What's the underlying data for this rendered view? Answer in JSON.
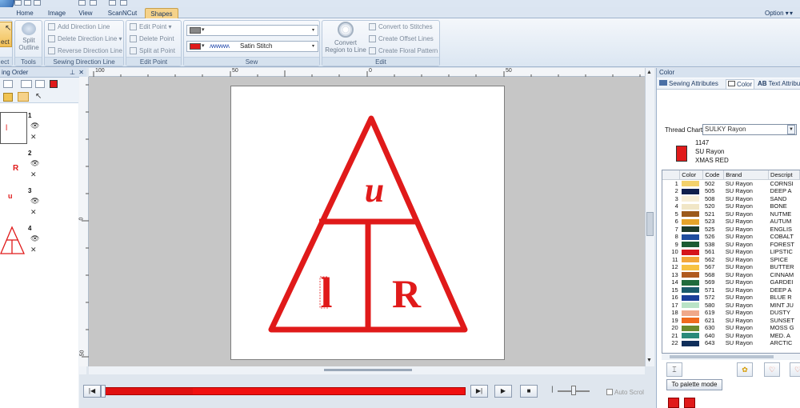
{
  "ribbon_tabs": [
    "Home",
    "Image",
    "View",
    "ScanNCut",
    "Shapes"
  ],
  "active_tab": "Shapes",
  "option_label": "Option",
  "groups": {
    "select": {
      "button": "ect",
      "title": "ect"
    },
    "tools": {
      "button_line1": "Split",
      "button_line2": "Outline",
      "title": "Tools"
    },
    "sewing_direction": {
      "items": [
        "Add Direction Line",
        "Delete Direction Line",
        "Reverse Direction Line"
      ],
      "title": "Sewing Direction Line"
    },
    "edit_point": {
      "items": [
        "Edit Point",
        "Delete Point",
        "Split at Point"
      ],
      "title": "Edit Point"
    },
    "sew": {
      "stitch_type": "Satin Stitch",
      "title": "Sew"
    },
    "edit": {
      "convert_line1": "Convert",
      "convert_line2": "Region to Line",
      "items": [
        "Convert to Stitches",
        "Create Offset Lines",
        "Create Floral Pattern"
      ],
      "title": "Edit"
    }
  },
  "left_panel": {
    "title": "ing Order",
    "items": [
      {
        "num": "1",
        "glyph": "l"
      },
      {
        "num": "2",
        "glyph": "R"
      },
      {
        "num": "3",
        "glyph": "u"
      },
      {
        "num": "4",
        "glyph": ""
      }
    ]
  },
  "ruler": {
    "h_labels": [
      "100",
      "50",
      "0",
      "50"
    ],
    "v_labels": [
      "0",
      "50"
    ]
  },
  "canvas_design": {
    "top_letter": "u",
    "left_letter": "l",
    "right_letter": "R",
    "color": "#e01a1a"
  },
  "player": {
    "auto_scroll": "Auto Scrol"
  },
  "right_panel": {
    "title": "Color",
    "tabs": [
      "Sewing Attributes",
      "Color",
      "Text Attribu"
    ],
    "thread_chart_label": "Thread Chart:",
    "thread_chart_value": "SULKY Rayon",
    "current": {
      "code": "1147",
      "brand": "SU Rayon",
      "name": "XMAS RED",
      "color": "#e01a1a"
    },
    "columns": [
      "",
      "Color",
      "Code",
      "Brand",
      "Descript"
    ],
    "rows": [
      {
        "n": "1",
        "color": "#f3d16b",
        "code": "502",
        "brand": "SU Rayon",
        "desc": "CORNSI"
      },
      {
        "n": "2",
        "color": "#0f1f4d",
        "code": "505",
        "brand": "SU Rayon",
        "desc": "DEEP A"
      },
      {
        "n": "3",
        "color": "#f7efd8",
        "code": "508",
        "brand": "SU Rayon",
        "desc": "SAND"
      },
      {
        "n": "4",
        "color": "#f1e6c6",
        "code": "520",
        "brand": "SU Rayon",
        "desc": "BONE"
      },
      {
        "n": "5",
        "color": "#9c5a1c",
        "code": "521",
        "brand": "SU Rayon",
        "desc": "NUTME"
      },
      {
        "n": "6",
        "color": "#e6a32a",
        "code": "523",
        "brand": "SU Rayon",
        "desc": "AUTUM"
      },
      {
        "n": "7",
        "color": "#1d3b2a",
        "code": "525",
        "brand": "SU Rayon",
        "desc": "ENGLIS"
      },
      {
        "n": "8",
        "color": "#1f4d9e",
        "code": "526",
        "brand": "SU Rayon",
        "desc": "COBALT"
      },
      {
        "n": "9",
        "color": "#1b5b33",
        "code": "538",
        "brand": "SU Rayon",
        "desc": "FOREST"
      },
      {
        "n": "10",
        "color": "#d5151c",
        "code": "561",
        "brand": "SU Rayon",
        "desc": "LIPSTIC"
      },
      {
        "n": "11",
        "color": "#f2a63a",
        "code": "562",
        "brand": "SU Rayon",
        "desc": "SPICE"
      },
      {
        "n": "12",
        "color": "#f7c242",
        "code": "567",
        "brand": "SU Rayon",
        "desc": "BUTTER"
      },
      {
        "n": "13",
        "color": "#b05a1e",
        "code": "568",
        "brand": "SU Rayon",
        "desc": "CINNAM"
      },
      {
        "n": "14",
        "color": "#1f6b3d",
        "code": "569",
        "brand": "SU Rayon",
        "desc": "GARDEI"
      },
      {
        "n": "15",
        "color": "#1a5a6b",
        "code": "571",
        "brand": "SU Rayon",
        "desc": "DEEP A"
      },
      {
        "n": "16",
        "color": "#1c3f9a",
        "code": "572",
        "brand": "SU Rayon",
        "desc": "BLUE R"
      },
      {
        "n": "17",
        "color": "#b9e3c6",
        "code": "580",
        "brand": "SU Rayon",
        "desc": "MINT JU"
      },
      {
        "n": "18",
        "color": "#f0a88a",
        "code": "619",
        "brand": "SU Rayon",
        "desc": "DUSTY"
      },
      {
        "n": "19",
        "color": "#f06a1e",
        "code": "621",
        "brand": "SU Rayon",
        "desc": "SUNSET"
      },
      {
        "n": "20",
        "color": "#6b8a2e",
        "code": "630",
        "brand": "SU Rayon",
        "desc": "MOSS G"
      },
      {
        "n": "21",
        "color": "#2a8a7a",
        "code": "640",
        "brand": "SU Rayon",
        "desc": "MED. A"
      },
      {
        "n": "22",
        "color": "#0f2e5a",
        "code": "643",
        "brand": "SU Rayon",
        "desc": "ARCTIC"
      }
    ],
    "palette_button": "To palette mode"
  }
}
